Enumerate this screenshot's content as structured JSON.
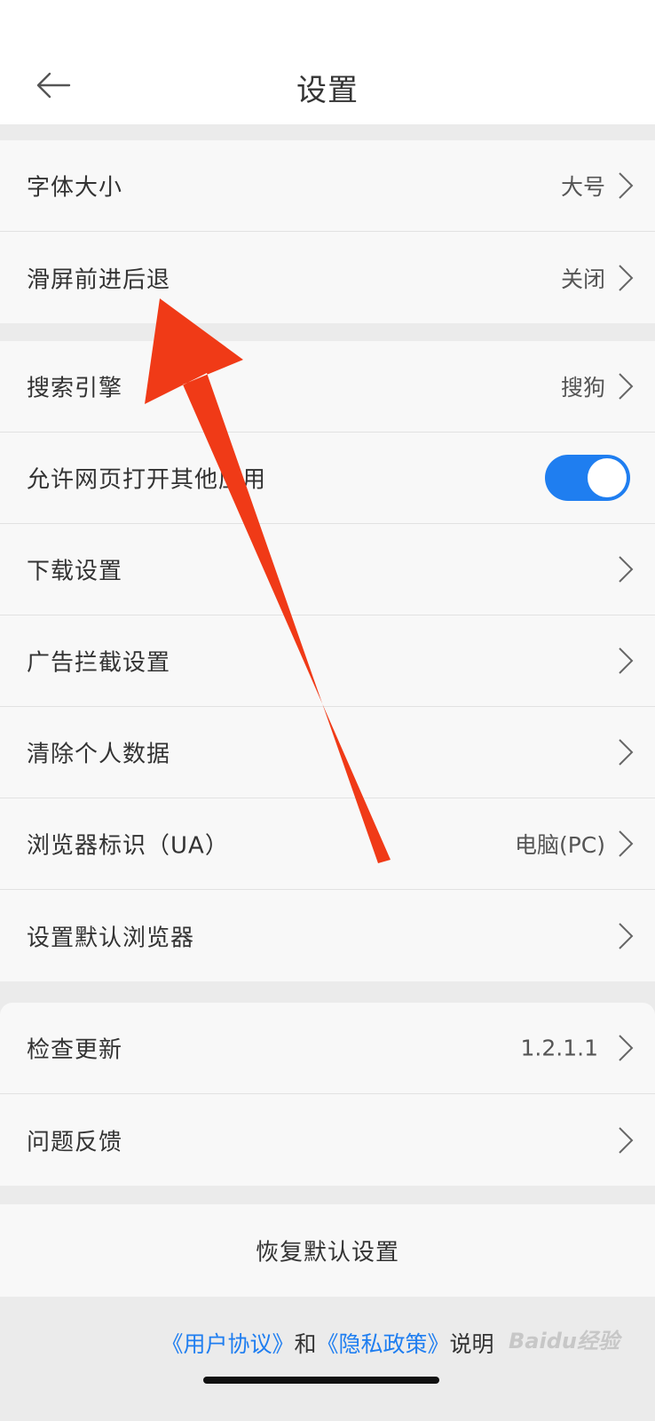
{
  "header": {
    "title": "设置",
    "back_icon": "arrow-left-icon"
  },
  "colors": {
    "accent": "#1f7ef0",
    "link": "#1f7ef0",
    "annotation_arrow": "#f03a17",
    "page_bg": "#ebebeb",
    "row_bg": "#f8f8f8"
  },
  "groups": [
    {
      "items": [
        {
          "label": "字体大小",
          "value": "大号"
        },
        {
          "label": "滑屏前进后退",
          "value": "关闭"
        }
      ]
    },
    {
      "items": [
        {
          "label": "搜索引擎",
          "value": "搜狗"
        },
        {
          "label": "允许网页打开其他应用",
          "toggle": true
        },
        {
          "label": "下载设置",
          "value": ""
        },
        {
          "label": "广告拦截设置",
          "value": ""
        },
        {
          "label": "清除个人数据",
          "value": ""
        },
        {
          "label": "浏览器标识（UA）",
          "value": "电脑(PC)"
        },
        {
          "label": "设置默认浏览器",
          "value": ""
        }
      ]
    },
    {
      "items": [
        {
          "label": "检查更新",
          "value": "1.2.1.1"
        },
        {
          "label": "问题反馈",
          "value": ""
        }
      ]
    }
  ],
  "restore": {
    "label": "恢复默认设置"
  },
  "footer": {
    "user_agreement": "《用户协议》",
    "and": "和",
    "privacy_policy": "《隐私政策》",
    "suffix": "说明",
    "watermark": "Baidu经验"
  }
}
